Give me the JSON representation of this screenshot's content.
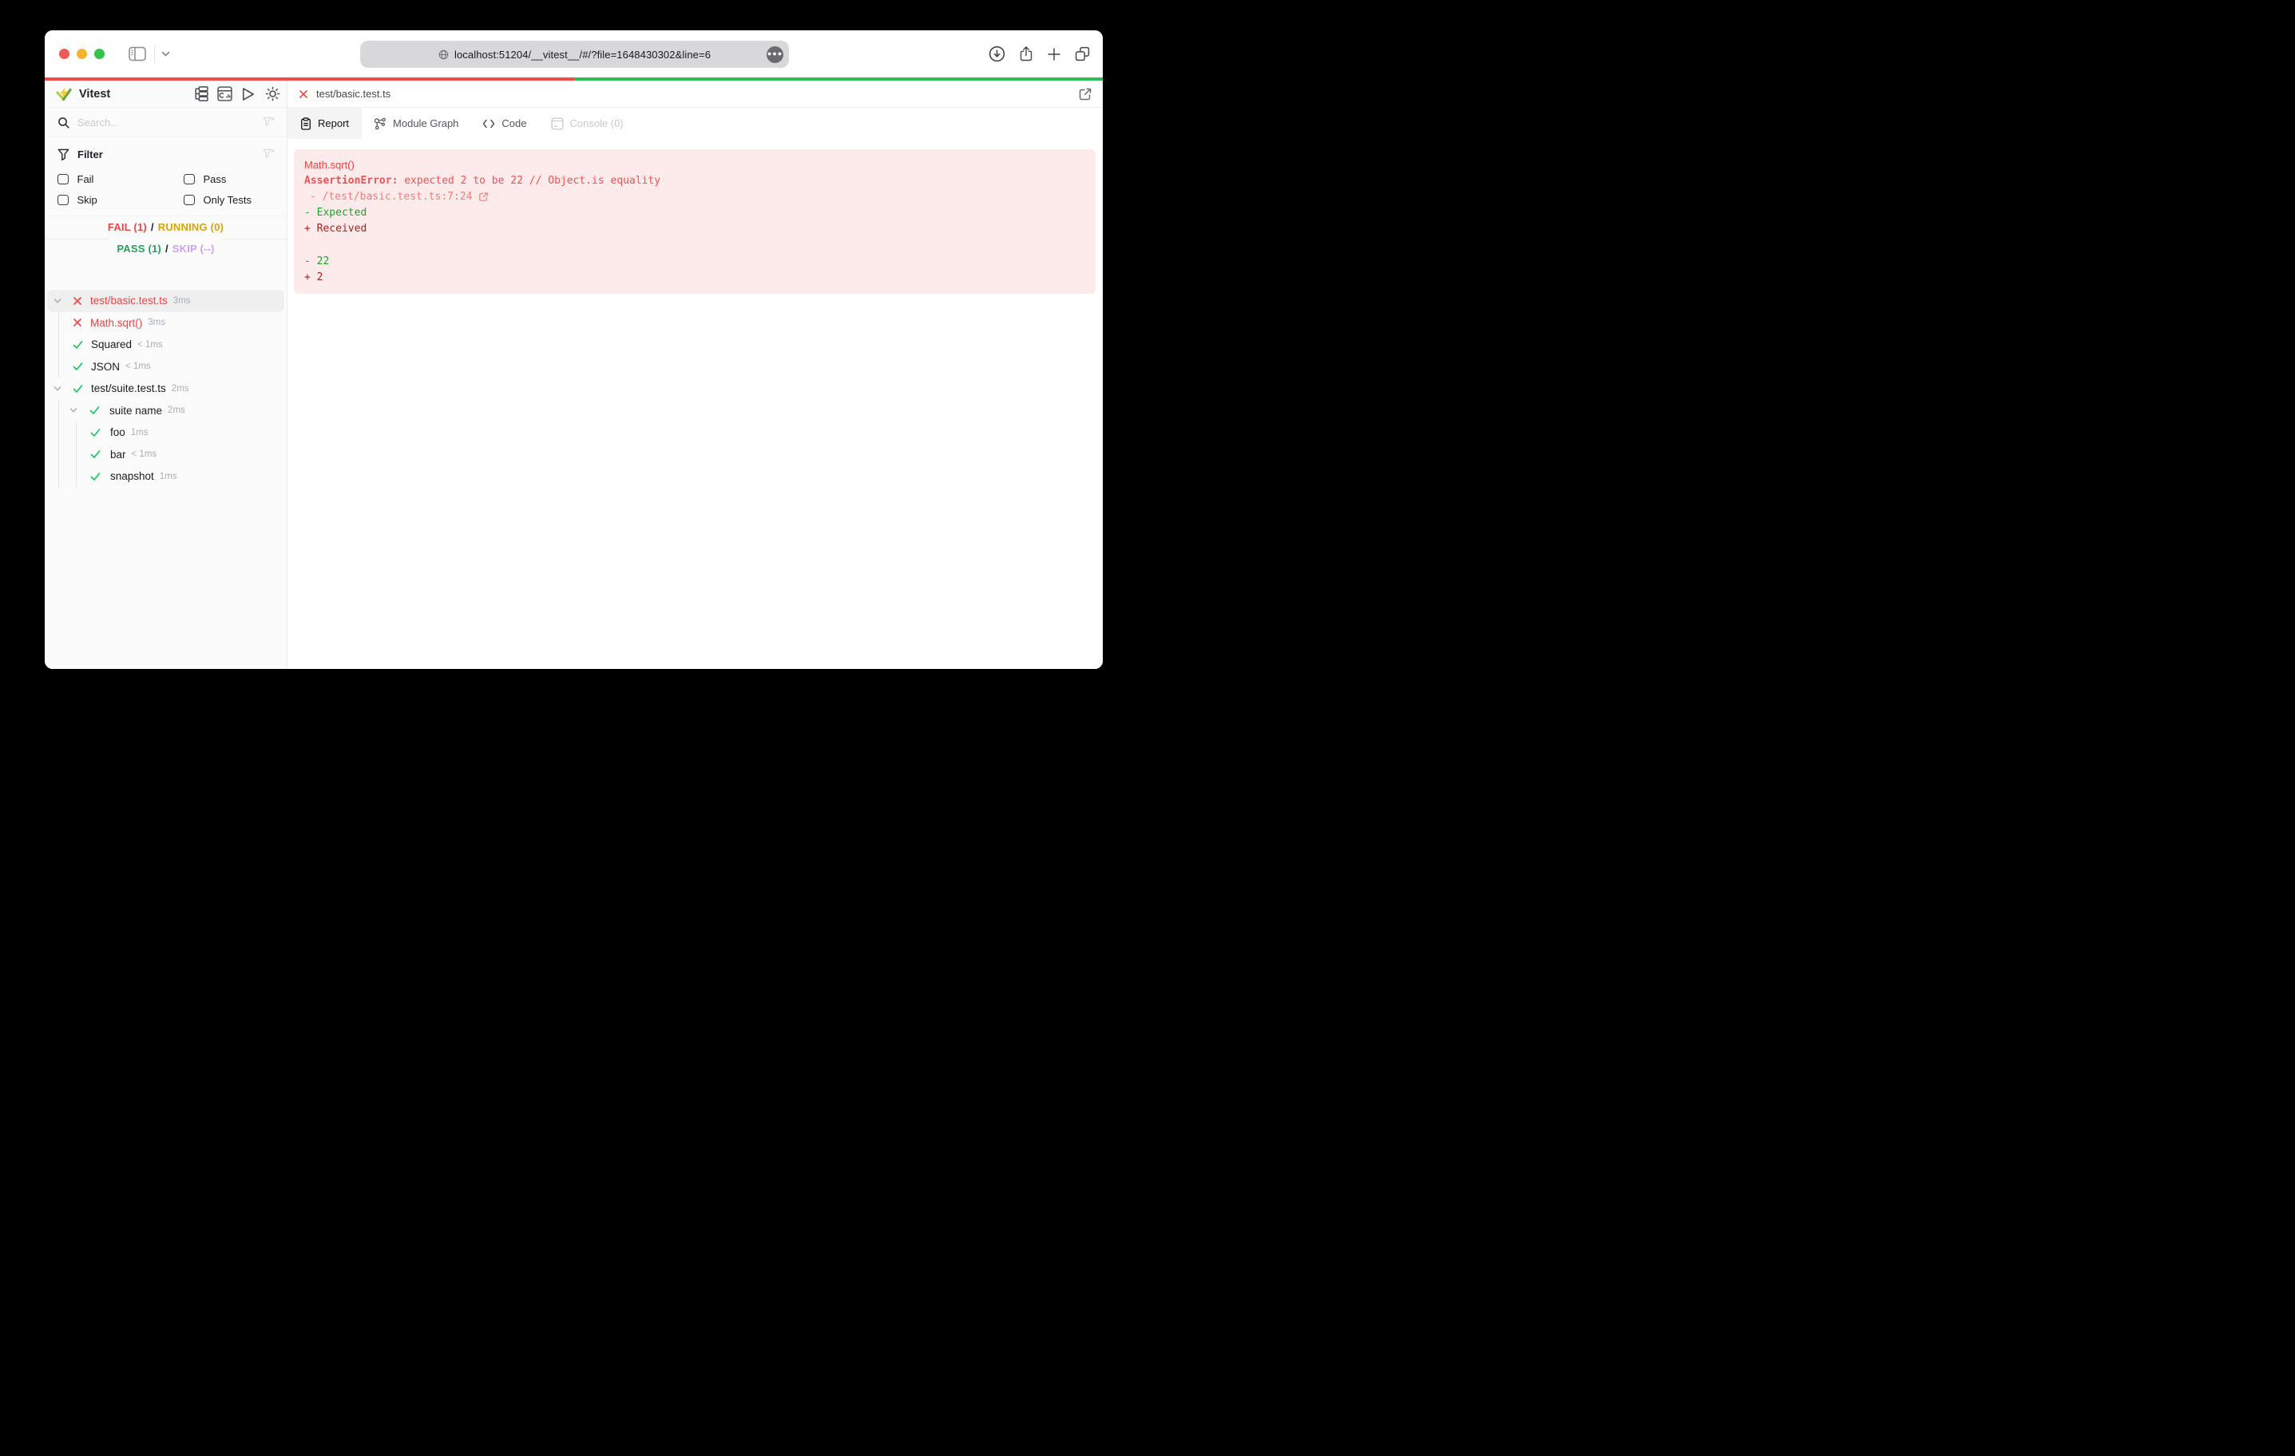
{
  "browser": {
    "url": "localhost:51204/__vitest__/#/?file=1648430302&line=6",
    "progress_bar": {
      "fail_ratio": 0.5,
      "pass_ratio": 0.5
    }
  },
  "sidebar": {
    "app_title": "Vitest",
    "search_placeholder": "Search...",
    "filter": {
      "title": "Filter",
      "options": [
        "Fail",
        "Pass",
        "Skip",
        "Only Tests"
      ]
    },
    "summary": {
      "fail": "FAIL (1)",
      "running": "RUNNING (0)",
      "pass": "PASS (1)",
      "skip": "SKIP (--)",
      "sep": "/"
    },
    "tree": [
      {
        "label": "test/basic.test.ts",
        "duration": "3ms",
        "status": "fail",
        "depth": 0,
        "expandable": true,
        "selected": true
      },
      {
        "label": "Math.sqrt()",
        "duration": "3ms",
        "status": "fail",
        "depth": 1
      },
      {
        "label": "Squared",
        "duration": "< 1ms",
        "status": "pass",
        "depth": 1
      },
      {
        "label": "JSON",
        "duration": "< 1ms",
        "status": "pass",
        "depth": 1
      },
      {
        "label": "test/suite.test.ts",
        "duration": "2ms",
        "status": "pass",
        "depth": 0,
        "expandable": true
      },
      {
        "label": "suite name",
        "duration": "2ms",
        "status": "pass",
        "depth": 1,
        "expandable": true
      },
      {
        "label": "foo",
        "duration": "1ms",
        "status": "pass",
        "depth": 2
      },
      {
        "label": "bar",
        "duration": "< 1ms",
        "status": "pass",
        "depth": 2
      },
      {
        "label": "snapshot",
        "duration": "1ms",
        "status": "pass",
        "depth": 2
      }
    ]
  },
  "main": {
    "file_header": "test/basic.test.ts",
    "tabs": [
      {
        "label": "Report",
        "active": true
      },
      {
        "label": "Module Graph"
      },
      {
        "label": "Code"
      },
      {
        "label": "Console (0)",
        "disabled": true
      }
    ],
    "report": {
      "test_name": "Math.sqrt()",
      "error_name": "AssertionError:",
      "error_message": " expected 2 to be 22 // Object.is equality",
      "stack_line": "- /test/basic.test.ts:7:24",
      "expected_label": "- Expected",
      "received_label": "+ Received",
      "expected_diff": "- 22",
      "received_diff": "+ 2"
    }
  },
  "colors": {
    "fail": "#ef4444",
    "pass": "#22c55e",
    "running": "#d9a406",
    "skip": "#c9a2f7",
    "duration_gray": "#a8adb4",
    "error_panel_bg": "#fdeaea",
    "stack_red": "#f47d7d",
    "diff_add_green": "#1fa32f",
    "diff_del_red": "#ab1f1f",
    "progress_fail": "#f34b4b",
    "progress_pass": "#2ebd58"
  },
  "icons": [
    "close-light",
    "minimize-light",
    "zoom-light",
    "sidebar-toggle-icon",
    "chevron-down-icon",
    "globe-icon",
    "more-icon",
    "download-icon",
    "share-icon",
    "new-tab-icon",
    "tab-overview-icon",
    "vitest-logo",
    "tree-view-icon",
    "dashboard-icon",
    "run-all-icon",
    "theme-toggle-icon",
    "search-icon",
    "clear-search-filter-icon",
    "filter-icon",
    "clear-filter-icon",
    "collapse-chevron-icon",
    "fail-x-icon",
    "pass-check-icon",
    "report-icon",
    "module-graph-icon",
    "code-icon",
    "console-icon",
    "open-in-external-icon",
    "open-in-editor-icon"
  ]
}
